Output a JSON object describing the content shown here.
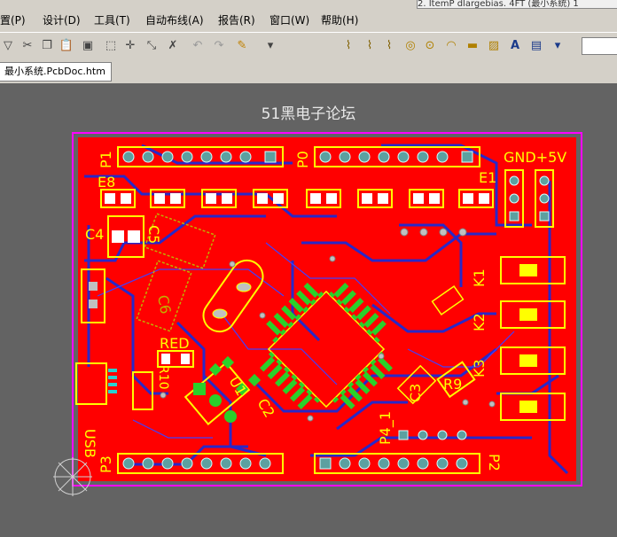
{
  "window_title_fragment": "2. ItemP dlargebias. 4FT (最小系统) 1",
  "menu": {
    "items": [
      "置(P)",
      "设计(D)",
      "工具(T)",
      "自动布线(A)",
      "报告(R)",
      "窗口(W)",
      "帮助(H)"
    ]
  },
  "document_tab": {
    "label": "最小系统.PcbDoc.htm"
  },
  "workspace": {
    "title": "51黑电子论坛"
  },
  "pcb_labels": {
    "p1": "P1",
    "p0": "P0",
    "e8": "E8",
    "e1": "E1",
    "gnd5v": "GND+5V",
    "c4": "C4",
    "c5": "C5",
    "c6": "C6",
    "red": "RED",
    "r10": "R10",
    "u1": "U1",
    "c2": "C2",
    "usb": "USB",
    "p3": "P3",
    "p4_1": "P4_1",
    "c3": "C3",
    "r9": "R9",
    "k1": "K1",
    "k2": "K2",
    "k3": "K3",
    "p2": "P2"
  },
  "colors": {
    "board_red": "#ff0000",
    "outline_magenta": "#ff00ff",
    "silk_yellow": "#ffff00",
    "trace_blue": "#2020c8",
    "pad_green": "#00d000",
    "background": "#636363"
  }
}
